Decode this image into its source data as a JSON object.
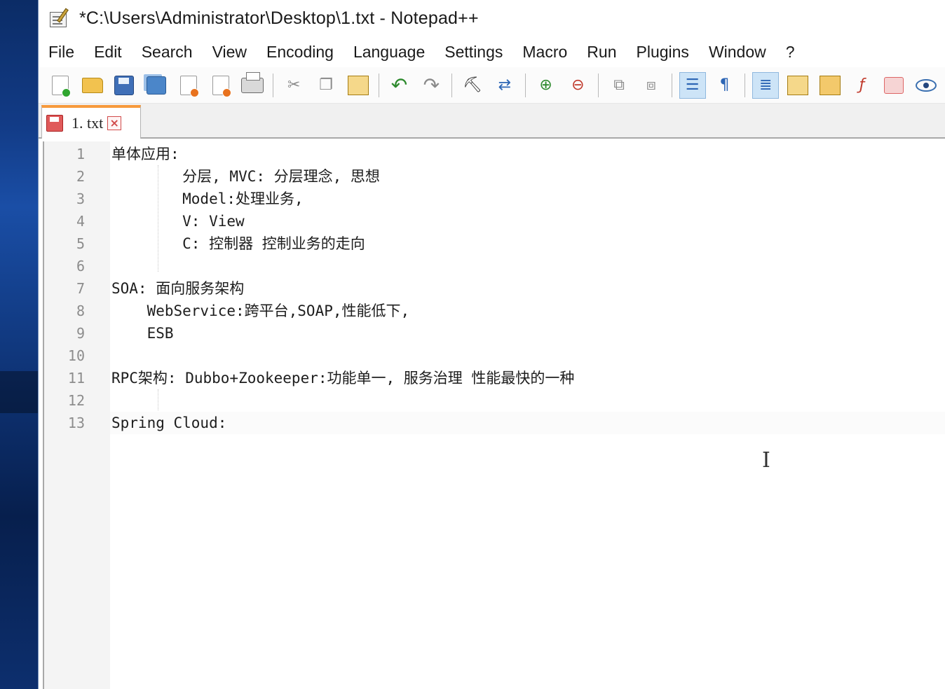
{
  "window": {
    "title": "*C:\\Users\\Administrator\\Desktop\\1.txt - Notepad++"
  },
  "menu": [
    "File",
    "Edit",
    "Search",
    "View",
    "Encoding",
    "Language",
    "Settings",
    "Macro",
    "Run",
    "Plugins",
    "Window",
    "?"
  ],
  "toolbar": {
    "icons": [
      "new-file-icon",
      "open-file-icon",
      "save-icon",
      "save-all-icon",
      "close-icon",
      "close-all-icon",
      "print-icon",
      "cut-icon",
      "copy-icon",
      "paste-icon",
      "undo-icon",
      "redo-icon",
      "find-icon",
      "replace-icon",
      "zoom-in-icon",
      "zoom-out-icon",
      "sync-vertical-icon",
      "sync-horizontal-icon",
      "word-wrap-icon",
      "show-all-characters-icon",
      "indent-guide-icon",
      "user-language-icon",
      "document-map-icon",
      "function-list-icon",
      "folder-as-workspace-icon",
      "monitoring-icon"
    ]
  },
  "tab": {
    "label": "1. txt"
  },
  "editor": {
    "line_numbers": [
      "1",
      "2",
      "3",
      "4",
      "5",
      "6",
      "7",
      "8",
      "9",
      "10",
      "11",
      "12",
      "13"
    ],
    "lines": [
      "单体应用:",
      "        分层, MVC: 分层理念, 思想",
      "        Model:处理业务,",
      "        V: View",
      "        C: 控制器 控制业务的走向",
      "",
      "SOA: 面向服务架构",
      "    WebService:跨平台,SOAP,性能低下,",
      "    ESB",
      "",
      "RPC架构: Dubbo+Zookeeper:功能单一, 服务治理 性能最快的一种",
      "",
      "Spring Cloud:"
    ]
  }
}
